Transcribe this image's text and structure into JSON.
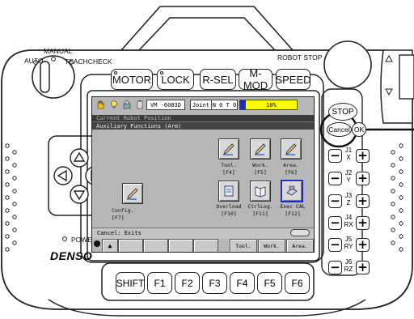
{
  "mode_labels": {
    "auto": "AUTO",
    "manual": "MANUAL",
    "teachcheck": "TEACHCHECK"
  },
  "robot_stop_label": "ROBOT STOP",
  "top_buttons": [
    "MOTOR",
    "LOCK",
    "R-SEL",
    "M-MOD",
    "SPEED"
  ],
  "right_buttons": {
    "stop": "STOP",
    "cancel": "Cancel",
    "ok": "OK"
  },
  "power_label": "POWER",
  "brand": "DENSO",
  "screen": {
    "status": {
      "machine": "VM -6083D",
      "coord": "Joint",
      "indicator": "N 0 T 0",
      "speed": "10%"
    },
    "current_title": "Current Robot Position",
    "window_title": "Auxiliary Functions (Arm)",
    "functions": [
      {
        "name": "Tool.",
        "key": "[F4]",
        "icon": "pencil-icon",
        "selected": false
      },
      {
        "name": "Work.",
        "key": "[F5]",
        "icon": "pencil-icon",
        "selected": false
      },
      {
        "name": "Area.",
        "key": "[F6]",
        "icon": "pencil-icon",
        "selected": false
      },
      {
        "name": "Config.",
        "key": "[F7]",
        "icon": "pencil-icon",
        "selected": false
      },
      {
        "name": "Overload",
        "key": "[F10]",
        "icon": "document-icon",
        "selected": false
      },
      {
        "name": "CtrlLog.",
        "key": "[F11]",
        "icon": "book-icon",
        "selected": false
      },
      {
        "name": "Exec CAL",
        "key": "[F12]",
        "icon": "calibrate-icon",
        "selected": true
      }
    ],
    "message": "Cancel: Exits",
    "softkeys": [
      "",
      "",
      "",
      "",
      "Tool.",
      "Work.",
      "Area."
    ]
  },
  "jog_axes": [
    {
      "top": "J1",
      "bottom": "X"
    },
    {
      "top": "J2",
      "bottom": "Y"
    },
    {
      "top": "J3",
      "bottom": "Z"
    },
    {
      "top": "J4",
      "bottom": "RX"
    },
    {
      "top": "J5",
      "bottom": "RY"
    },
    {
      "top": "J6",
      "bottom": "RZ"
    }
  ],
  "jog_signs": {
    "minus": "−",
    "plus": "+"
  },
  "bottom_buttons": [
    "SHIFT",
    "F1",
    "F2",
    "F3",
    "F4",
    "F5",
    "F6"
  ],
  "colors": {
    "speed_bar": "#ffff00",
    "selection": "#1a2ccf",
    "screen_bg": "#b7b7b7"
  }
}
